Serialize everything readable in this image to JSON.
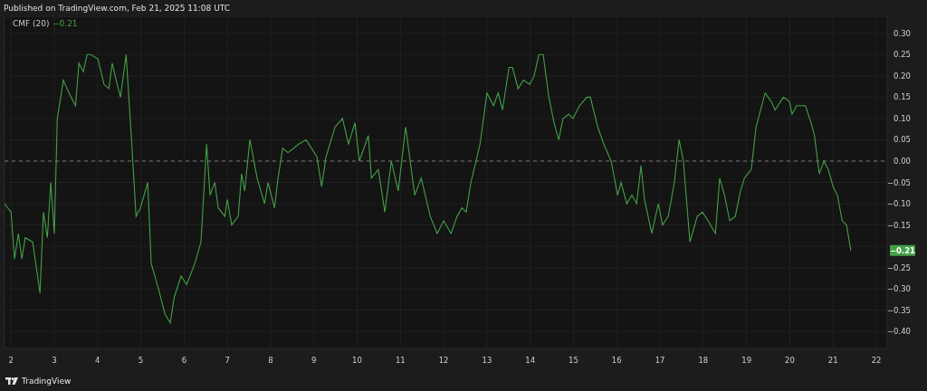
{
  "header": {
    "text": "Published on TradingView.com, Feb 21, 2025 11:08 UTC"
  },
  "chart": {
    "legend": {
      "value": "−0.21"
    },
    "last_value_label": "−0.21",
    "chart_data": {
      "type": "line",
      "x": [
        1.85,
        2.0,
        2.08,
        2.17,
        2.25,
        2.33,
        2.5,
        2.67,
        2.75,
        2.84,
        2.92,
        3.0,
        3.07,
        3.21,
        3.34,
        3.49,
        3.57,
        3.67,
        3.76,
        3.84,
        4.01,
        4.15,
        4.26,
        4.34,
        4.43,
        4.53,
        4.66,
        4.78,
        4.89,
        4.99,
        5.16,
        5.24,
        5.41,
        5.56,
        5.68,
        5.77,
        5.93,
        6.06,
        6.25,
        6.39,
        6.52,
        6.6,
        6.71,
        6.79,
        6.94,
        7.0,
        7.1,
        7.25,
        7.33,
        7.4,
        7.52,
        7.69,
        7.86,
        7.94,
        8.09,
        8.17,
        8.28,
        8.4,
        8.65,
        8.82,
        9.07,
        9.18,
        9.28,
        9.49,
        9.66,
        9.8,
        9.95,
        10.05,
        10.26,
        10.33,
        10.49,
        10.64,
        10.79,
        10.95,
        11.12,
        11.33,
        11.48,
        11.69,
        11.85,
        12.0,
        12.17,
        12.31,
        12.42,
        12.52,
        12.63,
        12.84,
        13.0,
        13.15,
        13.26,
        13.36,
        13.51,
        13.59,
        13.72,
        13.84,
        13.99,
        14.09,
        14.2,
        14.3,
        14.43,
        14.55,
        14.66,
        14.76,
        14.89,
        14.99,
        15.14,
        15.31,
        15.39,
        15.56,
        15.7,
        15.87,
        16.02,
        16.1,
        16.23,
        16.35,
        16.46,
        16.56,
        16.64,
        16.81,
        16.96,
        17.06,
        17.19,
        17.33,
        17.44,
        17.54,
        17.69,
        17.86,
        17.98,
        18.11,
        18.28,
        18.38,
        18.49,
        18.61,
        18.74,
        18.86,
        18.95,
        19.11,
        19.22,
        19.43,
        19.57,
        19.66,
        19.85,
        19.99,
        20.05,
        20.16,
        20.36,
        20.49,
        20.57,
        20.68,
        20.79,
        20.89,
        21.0,
        21.1,
        21.21,
        21.31,
        21.41
      ],
      "series": [
        {
          "name": "CMF (20)",
          "color": "#43a047",
          "values": [
            -0.1,
            -0.12,
            -0.23,
            -0.17,
            -0.23,
            -0.18,
            -0.19,
            -0.31,
            -0.12,
            -0.18,
            -0.05,
            -0.17,
            0.1,
            0.19,
            0.16,
            0.13,
            0.23,
            0.21,
            0.25,
            0.25,
            0.24,
            0.18,
            0.17,
            0.23,
            0.19,
            0.15,
            0.25,
            0.06,
            -0.13,
            -0.11,
            -0.05,
            -0.24,
            -0.3,
            -0.36,
            -0.38,
            -0.32,
            -0.27,
            -0.29,
            -0.24,
            -0.19,
            0.04,
            -0.08,
            -0.05,
            -0.11,
            -0.13,
            -0.09,
            -0.15,
            -0.13,
            -0.03,
            -0.07,
            0.05,
            -0.04,
            -0.1,
            -0.05,
            -0.11,
            -0.04,
            0.03,
            0.02,
            0.04,
            0.05,
            0.01,
            -0.06,
            0.01,
            0.08,
            0.1,
            0.04,
            0.09,
            0.0,
            0.06,
            -0.04,
            -0.02,
            -0.12,
            0.0,
            -0.07,
            0.08,
            -0.08,
            -0.04,
            -0.13,
            -0.17,
            -0.14,
            -0.17,
            -0.13,
            -0.11,
            -0.12,
            -0.05,
            0.04,
            0.16,
            0.13,
            0.16,
            0.12,
            0.22,
            0.22,
            0.17,
            0.19,
            0.18,
            0.2,
            0.25,
            0.25,
            0.15,
            0.09,
            0.05,
            0.1,
            0.11,
            0.1,
            0.13,
            0.15,
            0.15,
            0.08,
            0.04,
            0.0,
            -0.08,
            -0.05,
            -0.1,
            -0.08,
            -0.1,
            -0.01,
            -0.09,
            -0.17,
            -0.1,
            -0.15,
            -0.13,
            -0.05,
            0.05,
            0.0,
            -0.19,
            -0.13,
            -0.12,
            -0.14,
            -0.17,
            -0.04,
            -0.08,
            -0.14,
            -0.13,
            -0.07,
            -0.04,
            -0.02,
            0.08,
            0.16,
            0.14,
            0.12,
            0.15,
            0.14,
            0.11,
            0.13,
            0.13,
            0.09,
            0.06,
            -0.03,
            0.0,
            -0.02,
            -0.06,
            -0.08,
            -0.14,
            -0.15,
            -0.21
          ]
        }
      ],
      "xticks": [
        2,
        3,
        4,
        5,
        6,
        7,
        8,
        9,
        10,
        11,
        12,
        13,
        14,
        15,
        16,
        17,
        18,
        19,
        20,
        21,
        22
      ],
      "yticks": [
        {
          "value": 0.3,
          "label": "0.30"
        },
        {
          "value": 0.25,
          "label": "0.25"
        },
        {
          "value": 0.2,
          "label": "0.20"
        },
        {
          "value": 0.15,
          "label": "0.15"
        },
        {
          "value": 0.1,
          "label": "0.10"
        },
        {
          "value": 0.05,
          "label": "0.05"
        },
        {
          "value": 0,
          "label": "0.00"
        },
        {
          "value": -0.05,
          "label": "−0.05"
        },
        {
          "value": -0.1,
          "label": "−0.10"
        },
        {
          "value": -0.15,
          "label": "−0.15"
        },
        {
          "value": -0.25,
          "label": "−0.25"
        },
        {
          "value": -0.3,
          "label": "−0.30"
        },
        {
          "value": -0.35,
          "label": "−0.35"
        },
        {
          "value": -0.4,
          "label": "−0.40"
        }
      ],
      "xlim": [
        1.85,
        22.25
      ],
      "ylim": [
        -0.44,
        0.34
      ],
      "grid": true,
      "ref_lines": [
        {
          "axis": "y",
          "value": 0
        }
      ]
    }
  },
  "footer": {
    "brand": "TradingView"
  }
}
